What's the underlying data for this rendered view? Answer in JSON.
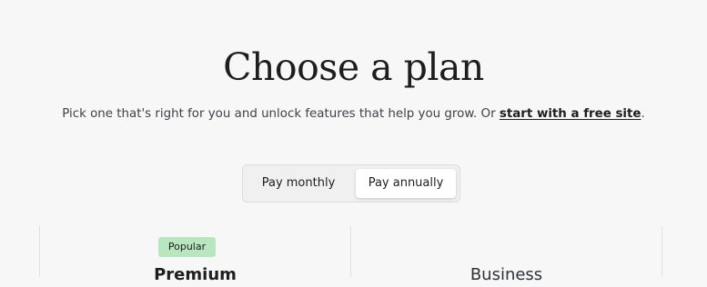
{
  "header": {
    "title": "Choose a plan",
    "subtitle_text": "Pick one that's right for you and unlock features that help you grow. Or ",
    "free_site_link": "start with a free site",
    "subtitle_end": "."
  },
  "billing_toggle": {
    "monthly_label": "Pay monthly",
    "annually_label": "Pay annually",
    "selected": "annually"
  },
  "plans": [
    {
      "badge": "Popular",
      "name": "Premium"
    },
    {
      "badge": "",
      "name": "Business"
    }
  ],
  "colors": {
    "background": "#f7f7f7",
    "badge_bg": "#b8e6bf",
    "text": "#1e1e1e",
    "divider": "#e0e0e0"
  }
}
